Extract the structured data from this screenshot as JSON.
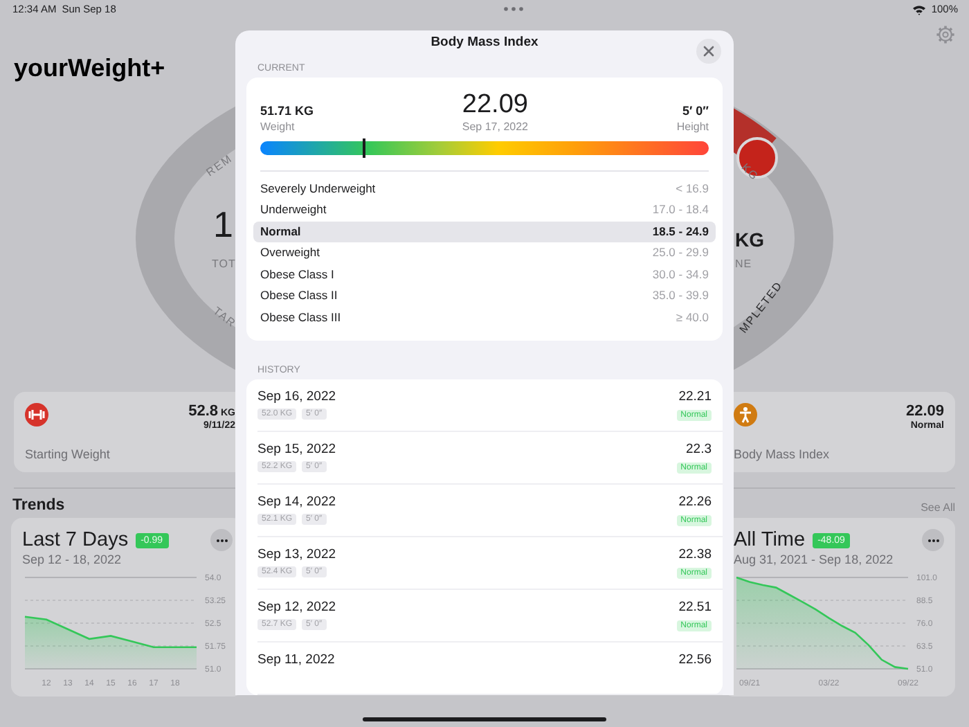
{
  "status_bar": {
    "time": "12:34 AM",
    "date": "Sun Sep 18",
    "battery": "100%"
  },
  "home": {
    "title": "yourWeight+",
    "gauge": {
      "labels": [
        {
          "text": "REM",
          "kind": "arc"
        },
        {
          "text": "1",
          "kind": "value"
        },
        {
          "text": "TOT",
          "kind": "caption"
        },
        {
          "text": "TAR",
          "kind": "arc"
        },
        {
          "text": "KG",
          "kind": "arc"
        },
        {
          "text": "KG",
          "kind": "value"
        },
        {
          "text": "NE",
          "kind": "caption"
        },
        {
          "text": "MPLETED",
          "kind": "arc"
        }
      ]
    },
    "stats": [
      {
        "kind": "weight",
        "label": "Starting Weight",
        "value": "52.8",
        "unit": "KG",
        "sub": "9/11/22"
      },
      {
        "kind": "bmi",
        "label": "Body Mass Index",
        "value": "22.09",
        "sub": "Normal"
      }
    ],
    "trends": {
      "title": "Trends",
      "see_all": "See All",
      "cards": [
        {
          "title": "Last 7 Days",
          "change": "-0.99",
          "range": "Sep 12 - 18, 2022",
          "chart_data": {
            "type": "area",
            "x": [
              11,
              12,
              13,
              14,
              15,
              16,
              17,
              18,
              19
            ],
            "grid": true,
            "series": [
              {
                "color": "#34c759",
                "values": [
                  52.71,
                  52.62,
                  52.3,
                  51.98,
                  52.08,
                  51.9,
                  51.71,
                  51.71,
                  51.71
                ]
              }
            ],
            "xlim": [
              11,
              19
            ],
            "ylim": [
              51.0,
              54.0
            ],
            "xticks": [
              12,
              13,
              14,
              15,
              16,
              17,
              18
            ],
            "yticks": [
              {
                "value": 51.0,
                "label": "51.0"
              },
              {
                "value": 51.75,
                "label": "51.75"
              },
              {
                "value": 52.5,
                "label": "52.5"
              },
              {
                "value": 53.25,
                "label": "53.25"
              },
              {
                "value": 54.0,
                "label": "54.0"
              }
            ]
          }
        },
        {
          "title": "All Time",
          "change": "-48.09",
          "range": "Aug 31, 2021 - Sep 18, 2022",
          "chart_data": {
            "type": "area",
            "categories": [
              null,
              "09/21",
              null,
              null,
              null,
              null,
              null,
              "03/22",
              null,
              null,
              null,
              null,
              null,
              "09/22"
            ],
            "grid": true,
            "series": [
              {
                "color": "#34c759",
                "values": [
                  101.0,
                  98.5,
                  96.8,
                  95.5,
                  91.5,
                  87.6,
                  83.5,
                  78.8,
                  74.5,
                  70.8,
                  64.0,
                  56.0,
                  52.0,
                  51.0
                ]
              }
            ],
            "ylim": [
              51.0,
              101.0
            ],
            "yticks": [
              {
                "value": 51.0,
                "label": "51.0"
              },
              {
                "value": 63.5,
                "label": "63.5"
              },
              {
                "value": 76.0,
                "label": "76.0"
              },
              {
                "value": 88.5,
                "label": "88.5"
              },
              {
                "value": 101.0,
                "label": "101.0"
              }
            ]
          }
        }
      ]
    }
  },
  "modal": {
    "title": "Body Mass Index",
    "current_label": "CURRENT",
    "current": {
      "weight": "51.71 KG",
      "weight_label": "Weight",
      "bmi": "22.09",
      "date": "Sep 17, 2022",
      "height": "5′ 0″",
      "height_label": "Height",
      "level": 0.23
    },
    "categories": [
      {
        "name": "Severely Underweight",
        "range": "< 16.9",
        "selected": false
      },
      {
        "name": "Underweight",
        "range": "17.0 - 18.4",
        "selected": false
      },
      {
        "name": "Normal",
        "range": "18.5 - 24.9",
        "selected": true
      },
      {
        "name": "Overweight",
        "range": "25.0 - 29.9",
        "selected": false
      },
      {
        "name": "Obese Class I",
        "range": "30.0 - 34.9",
        "selected": false
      },
      {
        "name": "Obese Class II",
        "range": "35.0 - 39.9",
        "selected": false
      },
      {
        "name": "Obese Class III",
        "range": "≥ 40.0",
        "selected": false
      }
    ],
    "history_label": "HISTORY",
    "history": [
      {
        "date": "Sep 16, 2022",
        "weight": "52.0 KG",
        "height": "5′ 0″",
        "bmi": "22.21",
        "status": "Normal"
      },
      {
        "date": "Sep 15, 2022",
        "weight": "52.2 KG",
        "height": "5′ 0″",
        "bmi": "22.3",
        "status": "Normal"
      },
      {
        "date": "Sep 14, 2022",
        "weight": "52.1 KG",
        "height": "5′ 0″",
        "bmi": "22.26",
        "status": "Normal"
      },
      {
        "date": "Sep 13, 2022",
        "weight": "52.4 KG",
        "height": "5′ 0″",
        "bmi": "22.38",
        "status": "Normal"
      },
      {
        "date": "Sep 12, 2022",
        "weight": "52.7 KG",
        "height": "5′ 0″",
        "bmi": "22.51",
        "status": "Normal"
      },
      {
        "date": "Sep 11, 2022",
        "bmi": "22.56"
      }
    ]
  }
}
